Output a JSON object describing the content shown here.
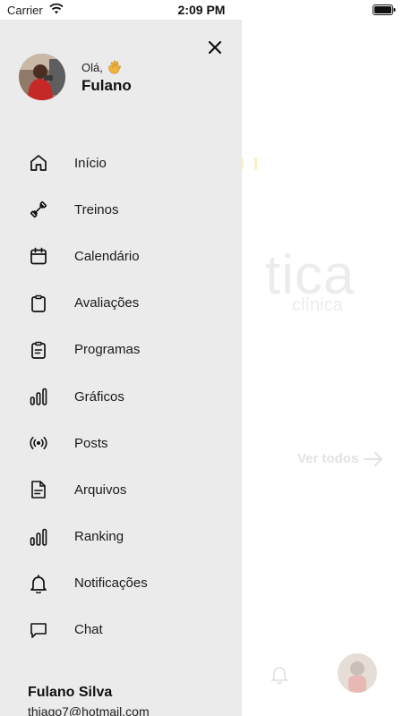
{
  "status_bar": {
    "carrier": "Carrier",
    "time": "2:09 PM"
  },
  "drawer": {
    "greeting": "Olá,",
    "first_name": "Fulano",
    "menu": [
      {
        "label": "Início",
        "icon": "home-icon"
      },
      {
        "label": "Treinos",
        "icon": "dumbbell-icon"
      },
      {
        "label": "Calendário",
        "icon": "calendar-icon"
      },
      {
        "label": "Avaliações",
        "icon": "clipboard-icon"
      },
      {
        "label": "Programas",
        "icon": "clipboard-list-icon"
      },
      {
        "label": "Gráficos",
        "icon": "bar-chart-icon"
      },
      {
        "label": "Posts",
        "icon": "broadcast-icon"
      },
      {
        "label": "Arquivos",
        "icon": "document-icon"
      },
      {
        "label": "Ranking",
        "icon": "ranking-icon"
      },
      {
        "label": "Notificações",
        "icon": "bell-icon"
      },
      {
        "label": "Chat",
        "icon": "chat-icon"
      }
    ],
    "footer": {
      "full_name": "Fulano Silva",
      "email": "thiago7@hotmail.com"
    }
  },
  "background": {
    "logo_main": "tica",
    "logo_sub": "clínica",
    "see_all": "Ver todos"
  },
  "colors": {
    "drawer_bg": "#ebebeb",
    "text": "#1a1a1a",
    "faded": "#e2e2e2"
  }
}
